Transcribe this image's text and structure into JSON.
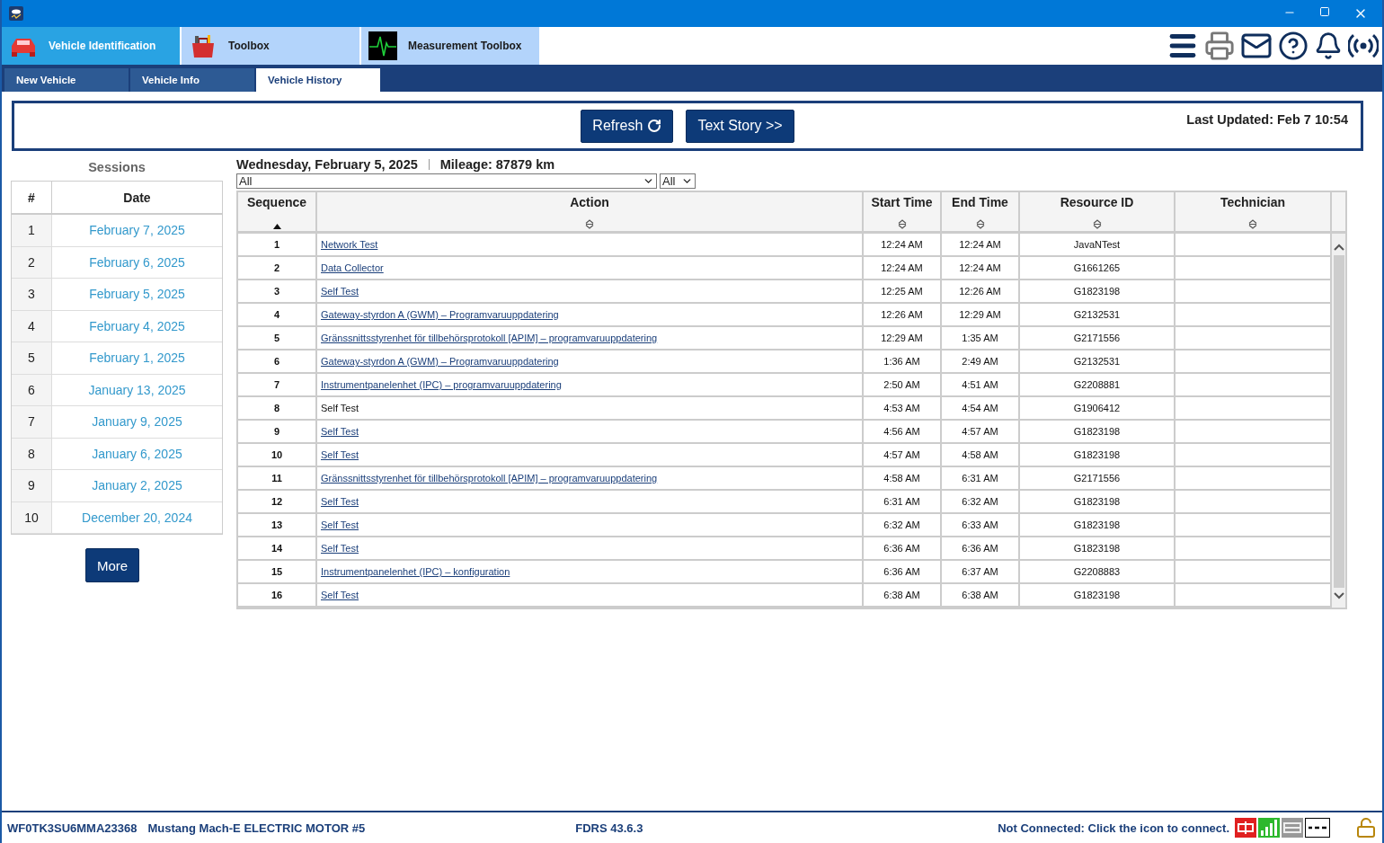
{
  "main_tabs": [
    {
      "label": "Vehicle Identification",
      "selected": true
    },
    {
      "label": "Toolbox",
      "selected": false
    },
    {
      "label": "Measurement Toolbox",
      "selected": false
    }
  ],
  "sub_tabs": [
    {
      "label": "New Vehicle",
      "selected": false
    },
    {
      "label": "Vehicle Info",
      "selected": false
    },
    {
      "label": "Vehicle History",
      "selected": true
    }
  ],
  "toolbar": {
    "buttons": [
      {
        "label": "Refresh",
        "kind": "refresh"
      },
      {
        "label": "Text Story >>",
        "kind": "plain"
      }
    ],
    "last_updated": "Last Updated: Feb 7 10:54"
  },
  "sessions": {
    "title": "Sessions",
    "columns": [
      "#",
      "Date"
    ],
    "rows": [
      {
        "number": "1",
        "date": "February 7, 2025"
      },
      {
        "number": "2",
        "date": "February 6, 2025"
      },
      {
        "number": "3",
        "date": "February 5, 2025"
      },
      {
        "number": "4",
        "date": "February 4, 2025"
      },
      {
        "number": "5",
        "date": "February 1, 2025"
      },
      {
        "number": "6",
        "date": "January 13, 2025"
      },
      {
        "number": "7",
        "date": "January 9, 2025"
      },
      {
        "number": "8",
        "date": "January 6, 2025"
      },
      {
        "number": "9",
        "date": "January 2, 2025"
      },
      {
        "number": "10",
        "date": "December 20, 2024"
      }
    ],
    "more_button": "More"
  },
  "history": {
    "date": "Wednesday, February 5, 2025",
    "mileage": "Mileage: 87879 km",
    "filters": [
      "All",
      "All"
    ],
    "columns": [
      {
        "label": "Sequence",
        "sorted": true
      },
      {
        "label": "Action",
        "sorted": false
      },
      {
        "label": "Start Time",
        "sorted": false
      },
      {
        "label": "End Time",
        "sorted": false
      },
      {
        "label": "Resource ID",
        "sorted": false
      },
      {
        "label": "Technician",
        "sorted": false
      }
    ],
    "rows": [
      {
        "sequence": "1",
        "action": "Network Test",
        "link": true,
        "start": "12:24 AM",
        "end": "12:24 AM",
        "resource": "JavaNTest"
      },
      {
        "sequence": "2",
        "action": "Data Collector",
        "link": true,
        "start": "12:24 AM",
        "end": "12:24 AM",
        "resource": "G1661265"
      },
      {
        "sequence": "3",
        "action": "Self Test",
        "link": true,
        "start": "12:25 AM",
        "end": "12:26 AM",
        "resource": "G1823198"
      },
      {
        "sequence": "4",
        "action": "Gateway-styrdon A (GWM) – Programvaruuppdatering",
        "link": true,
        "start": "12:26 AM",
        "end": "12:29 AM",
        "resource": "G2132531"
      },
      {
        "sequence": "5",
        "action": "Gränssnittsstyrenhet för tillbehörsprotokoll [APIM] – programvaruuppdatering",
        "link": true,
        "start": "12:29 AM",
        "end": "1:35 AM",
        "resource": "G2171556"
      },
      {
        "sequence": "6",
        "action": "Gateway-styrdon A (GWM) – Programvaruuppdatering",
        "link": true,
        "start": "1:36 AM",
        "end": "2:49 AM",
        "resource": "G2132531"
      },
      {
        "sequence": "7",
        "action": "Instrumentpanelenhet (IPC) – programvaruuppdatering",
        "link": true,
        "start": "2:50 AM",
        "end": "4:51 AM",
        "resource": "G2208881"
      },
      {
        "sequence": "8",
        "action": "Self Test",
        "link": false,
        "start": "4:53 AM",
        "end": "4:54 AM",
        "resource": "G1906412"
      },
      {
        "sequence": "9",
        "action": "Self Test",
        "link": true,
        "start": "4:56 AM",
        "end": "4:57 AM",
        "resource": "G1823198"
      },
      {
        "sequence": "10",
        "action": "Self Test",
        "link": true,
        "start": "4:57 AM",
        "end": "4:58 AM",
        "resource": "G1823198"
      },
      {
        "sequence": "11",
        "action": "Gränssnittsstyrenhet för tillbehörsprotokoll [APIM] – programvaruuppdatering",
        "link": true,
        "start": "4:58 AM",
        "end": "6:31 AM",
        "resource": "G2171556"
      },
      {
        "sequence": "12",
        "action": "Self Test",
        "link": true,
        "start": "6:31 AM",
        "end": "6:32 AM",
        "resource": "G1823198"
      },
      {
        "sequence": "13",
        "action": "Self Test",
        "link": true,
        "start": "6:32 AM",
        "end": "6:33 AM",
        "resource": "G1823198"
      },
      {
        "sequence": "14",
        "action": "Self Test",
        "link": true,
        "start": "6:36 AM",
        "end": "6:36 AM",
        "resource": "G1823198"
      },
      {
        "sequence": "15",
        "action": "Instrumentpanelenhet (IPC) – konfiguration",
        "link": true,
        "start": "6:36 AM",
        "end": "6:37 AM",
        "resource": "G2208883"
      },
      {
        "sequence": "16",
        "action": "Self Test",
        "link": true,
        "start": "6:38 AM",
        "end": "6:38 AM",
        "resource": "G1823198"
      }
    ]
  },
  "status_bar": {
    "vin": "WF0TK3SU6MMA23368",
    "vehicle": "Mustang Mach-E ELECTRIC MOTOR #5",
    "version": "FDRS 43.6.3",
    "connection": "Not Connected: Click the icon to connect."
  }
}
